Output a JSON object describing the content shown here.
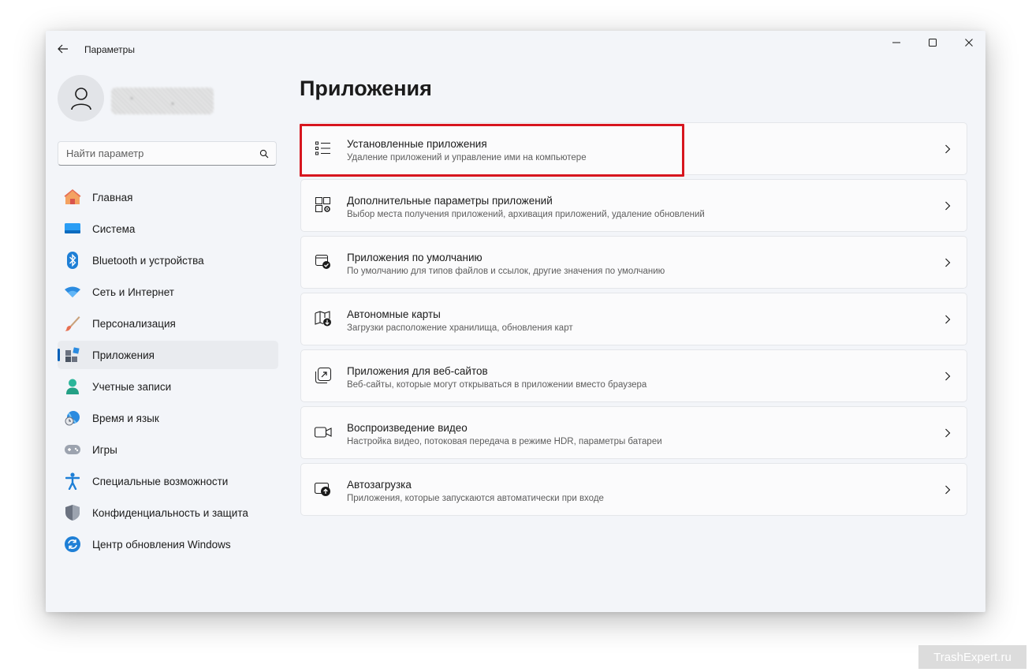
{
  "window": {
    "title": "Параметры"
  },
  "search": {
    "placeholder": "Найти параметр"
  },
  "sidebar": {
    "items": [
      {
        "label": "Главная",
        "icon": "home-icon"
      },
      {
        "label": "Система",
        "icon": "system-icon"
      },
      {
        "label": "Bluetooth и устройства",
        "icon": "bluetooth-icon"
      },
      {
        "label": "Сеть и Интернет",
        "icon": "wifi-icon"
      },
      {
        "label": "Персонализация",
        "icon": "brush-icon"
      },
      {
        "label": "Приложения",
        "icon": "apps-icon",
        "active": true
      },
      {
        "label": "Учетные записи",
        "icon": "account-icon"
      },
      {
        "label": "Время и язык",
        "icon": "time-language-icon"
      },
      {
        "label": "Игры",
        "icon": "gamepad-icon"
      },
      {
        "label": "Специальные возможности",
        "icon": "accessibility-icon"
      },
      {
        "label": "Конфиденциальность и защита",
        "icon": "shield-icon"
      },
      {
        "label": "Центр обновления Windows",
        "icon": "update-icon"
      }
    ]
  },
  "main": {
    "title": "Приложения",
    "cards": [
      {
        "title": "Установленные приложения",
        "subtitle": "Удаление приложений и управление ими на компьютере",
        "icon": "list-icon"
      },
      {
        "title": "Дополнительные параметры приложений",
        "subtitle": "Выбор места получения приложений, архивация приложений, удаление обновлений",
        "icon": "apps-settings-icon"
      },
      {
        "title": "Приложения по умолчанию",
        "subtitle": "По умолчанию для типов файлов и ссылок, другие значения по умолчанию",
        "icon": "default-apps-icon"
      },
      {
        "title": "Автономные карты",
        "subtitle": "Загрузки расположение хранилища, обновления карт",
        "icon": "offline-maps-icon"
      },
      {
        "title": "Приложения для веб-сайтов",
        "subtitle": "Веб-сайты, которые могут открываться в приложении вместо браузера",
        "icon": "web-apps-icon"
      },
      {
        "title": "Воспроизведение видео",
        "subtitle": "Настройка видео, потоковая передача в режиме HDR, параметры батареи",
        "icon": "video-icon"
      },
      {
        "title": "Автозагрузка",
        "subtitle": "Приложения, которые запускаются автоматически при входе",
        "icon": "startup-icon"
      }
    ]
  },
  "watermark": "TrashExpert.ru",
  "colors": {
    "accent": "#005fb8",
    "highlight": "#d7161f"
  }
}
